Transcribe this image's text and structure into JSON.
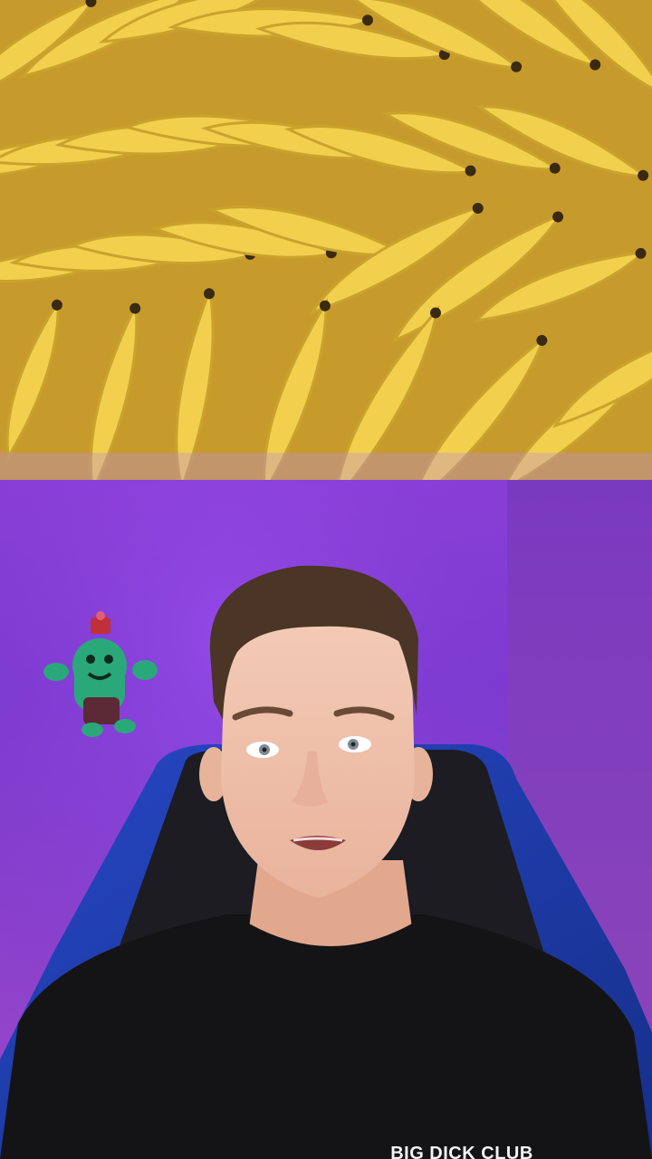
{
  "scene": {
    "top": "banana-bunches",
    "bottom": "person-in-gaming-chair"
  },
  "shirt": {
    "print_text": "BIG DICK CLUB"
  },
  "colors": {
    "banana_yellow": "#f2d04e",
    "banana_shadow": "#c9a32c",
    "banana_tip": "#3a2a12",
    "wall_purple": "#8a3fd8",
    "chair_blue": "#1f3fb0",
    "chair_black": "#1c1c22",
    "shirt_black": "#141416",
    "skin": "#f1c6ae",
    "hair": "#4a3526",
    "toy_green": "#2aa87a"
  }
}
